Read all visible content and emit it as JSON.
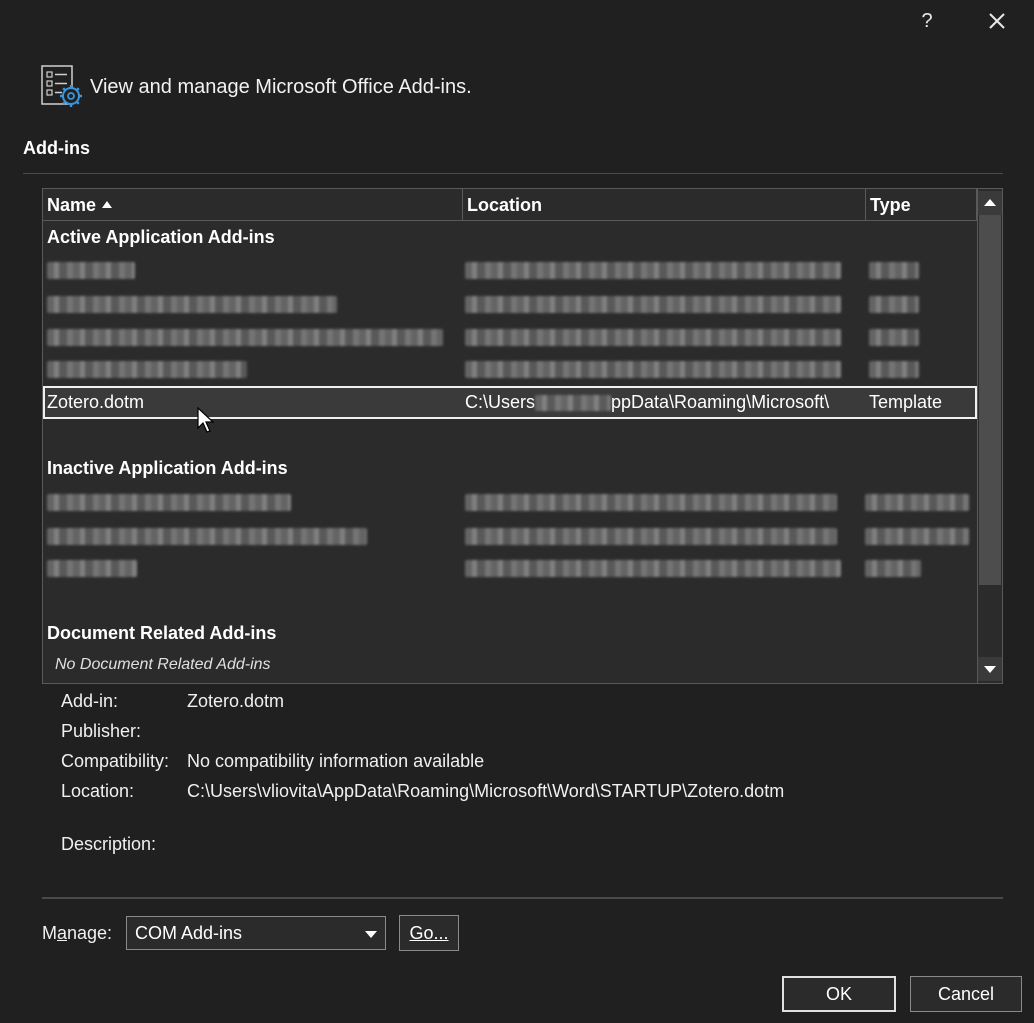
{
  "titlebar": {
    "help_label": "?"
  },
  "header": {
    "title": "View and manage Microsoft Office Add-ins."
  },
  "section_label": "Add-ins",
  "table": {
    "columns": {
      "name": "Name",
      "location": "Location",
      "type": "Type"
    },
    "groups": {
      "active": "Active Application Add-ins",
      "inactive": "Inactive Application Add-ins",
      "document": "Document Related Add-ins"
    },
    "selected_row": {
      "name": "Zotero.dotm",
      "location_prefix": "C:\\Users",
      "location_suffix": "ppData\\Roaming\\Microsoft\\",
      "type": "Template"
    },
    "no_document_text": "No Document Related Add-ins"
  },
  "details": {
    "addin_label": "Add-in:",
    "addin_value": "Zotero.dotm",
    "publisher_label": "Publisher:",
    "publisher_value": "",
    "compat_label": "Compatibility:",
    "compat_value": "No compatibility information available",
    "location_label": "Location:",
    "location_value": "C:\\Users\\vliovita\\AppData\\Roaming\\Microsoft\\Word\\STARTUP\\Zotero.dotm",
    "description_label": "Description:"
  },
  "manage": {
    "label_pre": "M",
    "label_acc": "a",
    "label_post": "nage:",
    "selected": "COM Add-ins",
    "go_label": "Go..."
  },
  "buttons": {
    "ok": "OK",
    "cancel": "Cancel"
  }
}
